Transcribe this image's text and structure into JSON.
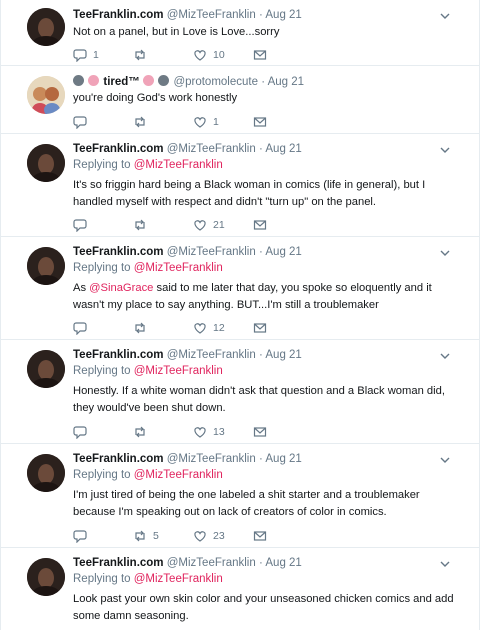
{
  "tweets": [
    {
      "name": "TeeFranklin.com",
      "handle": "@MizTeeFranklin",
      "dot": "·",
      "time": "Aug 21",
      "reply_prefix": "",
      "reply_mention": "",
      "text": "Not on a panel, but in Love is Love...sorry",
      "replies": "1",
      "retweets": "",
      "likes": "10"
    },
    {
      "name": "tired™",
      "handle": "@protomolecute",
      "dot": "·",
      "time": "Aug 21",
      "reply_prefix": "",
      "reply_mention": "",
      "text": "you're doing God's work honestly",
      "replies": "",
      "retweets": "",
      "likes": "1"
    },
    {
      "name": "TeeFranklin.com",
      "handle": "@MizTeeFranklin",
      "dot": "·",
      "time": "Aug 21",
      "reply_prefix": "Replying to",
      "reply_mention": "@MizTeeFranklin",
      "text": "It's so friggin hard being a Black woman in comics (life in general), but I handled myself with respect and didn't \"turn up\" on the panel.",
      "replies": "",
      "retweets": "",
      "likes": "21"
    },
    {
      "name": "TeeFranklin.com",
      "handle": "@MizTeeFranklin",
      "dot": "·",
      "time": "Aug 21",
      "reply_prefix": "Replying to",
      "reply_mention": "@MizTeeFranklin",
      "text_before": "As",
      "text_mention": "@SinaGrace",
      "text_after": "said to me later that day, you spoke so eloquently and it wasn't my place to say anything. BUT...I'm still a troublemaker",
      "replies": "",
      "retweets": "",
      "likes": "12"
    },
    {
      "name": "TeeFranklin.com",
      "handle": "@MizTeeFranklin",
      "dot": "·",
      "time": "Aug 21",
      "reply_prefix": "Replying to",
      "reply_mention": "@MizTeeFranklin",
      "text": "Honestly. If a white woman didn't ask that question and a Black woman did, they would've been shut down.",
      "replies": "",
      "retweets": "",
      "likes": "13"
    },
    {
      "name": "TeeFranklin.com",
      "handle": "@MizTeeFranklin",
      "dot": "·",
      "time": "Aug 21",
      "reply_prefix": "Replying to",
      "reply_mention": "@MizTeeFranklin",
      "text": "I'm just tired of being the one labeled a shit starter and a troublemaker because I'm speaking out on lack of creators of color in comics.",
      "replies": "",
      "retweets": "5",
      "likes": "23"
    },
    {
      "name": "TeeFranklin.com",
      "handle": "@MizTeeFranklin",
      "dot": "·",
      "time": "Aug 21",
      "reply_prefix": "Replying to",
      "reply_mention": "@MizTeeFranklin",
      "text": "Look past your own skin color and your unseasoned chicken comics and add some damn seasoning.",
      "replies": "",
      "retweets": "",
      "likes": ""
    }
  ],
  "colors": {
    "mention": "#e0245e",
    "secondary_text": "#657786",
    "divider": "#e6ecf0"
  },
  "icons": [
    "reply-icon",
    "retweet-icon",
    "heart-icon",
    "envelope-icon",
    "chevron-down-icon"
  ]
}
